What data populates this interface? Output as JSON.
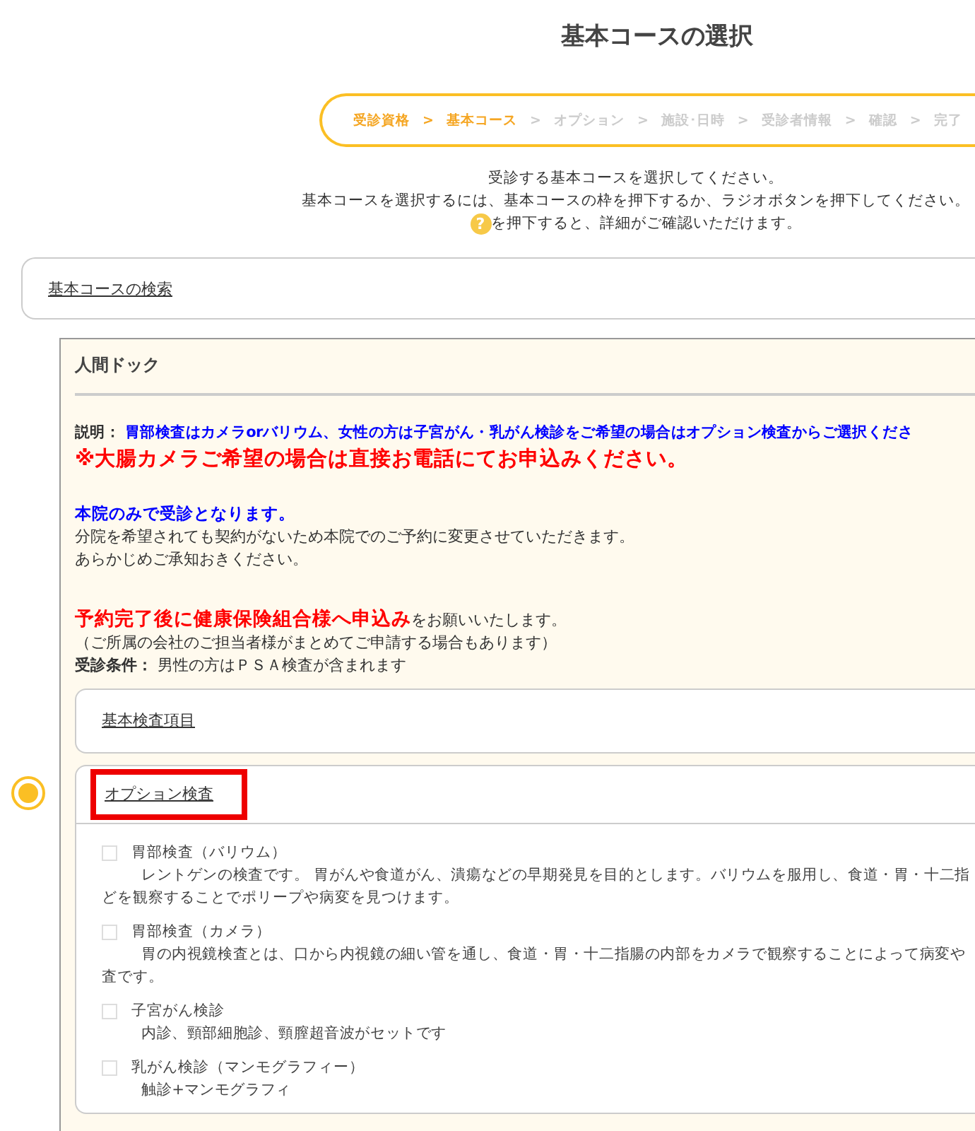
{
  "page_title": "基本コースの選択",
  "steps": [
    {
      "label": "受診資格",
      "reached": true,
      "separator": ">"
    },
    {
      "label": "基本コース",
      "reached": true,
      "separator": ">"
    },
    {
      "label": "オプション",
      "reached": false,
      "separator": ">"
    },
    {
      "label": "施設･日時",
      "reached": false,
      "separator": ">"
    },
    {
      "label": "受診者情報",
      "reached": false,
      "separator": ">"
    },
    {
      "label": "確認",
      "reached": false,
      "separator": ">"
    },
    {
      "label": "完了",
      "reached": false
    }
  ],
  "instructions": {
    "line_1": "受診する基本コースを選択してください。",
    "line_2": "基本コースを選択するには、基本コースの枠を押下するか、ラジオボタンを押下してください。",
    "help_icon": "?",
    "line_3": "を押下すると、詳細がご確認いただけます。"
  },
  "search_link": "基本コースの検索",
  "course": {
    "selected": true,
    "name": "人間ドック",
    "description_label": "説明：",
    "description": "胃部検査はカメラorバリウム、女性の方は子宮がん・乳がん検診をご希望の場合はオプション検査からご選択くださ",
    "warning": "※大腸カメラご希望の場合は直接お電話にてお申込みください。",
    "notice_title": "本院のみで受診となります。",
    "notice_lines": [
      "分院を希望されても契約がないため本院でのご予約に変更させていただきます。",
      "あらかじめご承知おきください。"
    ],
    "application_emphasis": "予約完了後に健康保険組合様へ申込み",
    "application_rest": "をお願いいたします。",
    "application_note": "（ご所属の会社のご担当者様がまとめてご申請する場合もあります）",
    "condition_label": "受診条件：",
    "condition": "男性の方はＰＳＡ検査が含まれます",
    "basic_items_link": "基本検査項目",
    "options_link": "オプション検査",
    "options_link_highlighted": true,
    "options": [
      {
        "name": "胃部検査（バリウム）",
        "checked": false,
        "lines": [
          "レントゲンの検査です。 胃がんや食道がん、潰瘍などの早期発見を目的とします。バリウムを服用し、食道・胃・十二指",
          "どを観察することでポリープや病変を見つけます。"
        ]
      },
      {
        "name": "胃部検査（カメラ）",
        "checked": false,
        "lines": [
          "胃の内視鏡検査とは、口から内視鏡の細い管を通し、食道・胃・十二指腸の内部をカメラで観察することによって病変や",
          "査です。"
        ]
      },
      {
        "name": "子宮がん検診",
        "checked": false,
        "lines": [
          "内診、頸部細胞診、頸膣超音波がセットです"
        ]
      },
      {
        "name": "乳がん検診（マンモグラフィー）",
        "checked": false,
        "lines": [
          "触診+マンモグラフィ"
        ]
      }
    ]
  }
}
